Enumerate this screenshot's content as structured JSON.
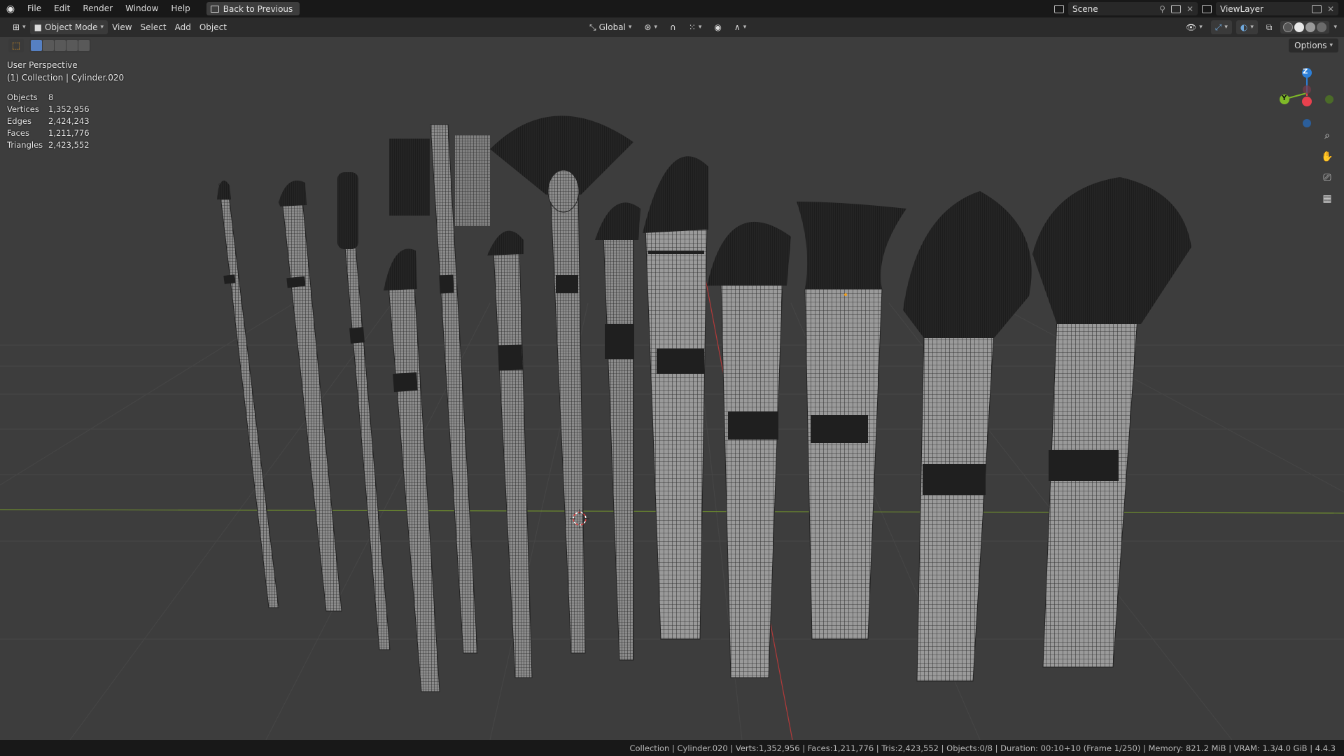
{
  "topbar": {
    "menu": [
      "File",
      "Edit",
      "Render",
      "Window",
      "Help"
    ],
    "back_label": "Back to Previous",
    "scene": "Scene",
    "view_layer": "ViewLayer"
  },
  "viewport_header": {
    "mode": "Object Mode",
    "menus": [
      "View",
      "Select",
      "Add",
      "Object"
    ],
    "orientation": "Global"
  },
  "toolbar": {
    "options_label": "Options"
  },
  "overlay": {
    "perspective": "User Perspective",
    "collection": "(1) Collection | Cylinder.020",
    "stats": [
      {
        "label": "Objects",
        "value": "8"
      },
      {
        "label": "Vertices",
        "value": "1,352,956"
      },
      {
        "label": "Edges",
        "value": "2,424,243"
      },
      {
        "label": "Faces",
        "value": "1,211,776"
      },
      {
        "label": "Triangles",
        "value": "2,423,552"
      }
    ]
  },
  "gizmo": {
    "z": "Z",
    "y": "Y",
    "axis_colors": {
      "x": "#e8414e",
      "y": "#7fb928",
      "z": "#2d80d8"
    }
  },
  "colors": {
    "viewport_bg": "#3d3d3d",
    "grid_line": "#474747",
    "bristle": "#1a1a1a",
    "handle": "#8a8a8a",
    "wire": "#2a2a2a",
    "accent_orange": "#f0a020"
  },
  "statusbar": {
    "text": "Collection | Cylinder.020 | Verts:1,352,956 | Faces:1,211,776 | Tris:2,423,552 | Objects:0/8 | Duration: 00:10+10 (Frame 1/250) | Memory: 821.2 MiB | VRAM: 1.3/4.0 GiB | 4.4.3"
  }
}
